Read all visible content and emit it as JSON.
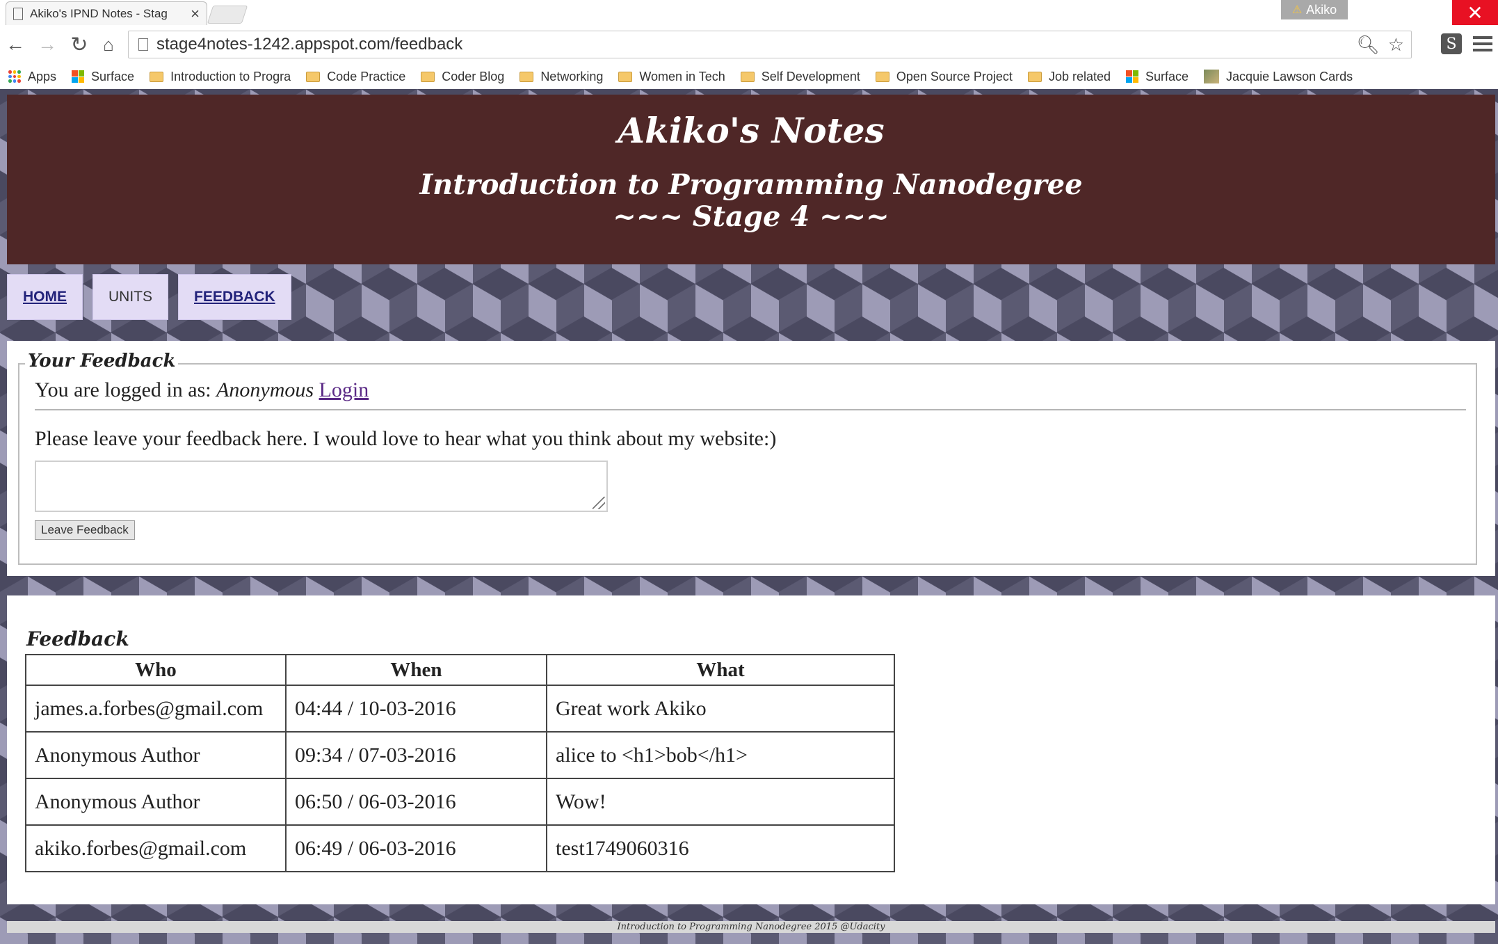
{
  "browser": {
    "tab_title": "Akiko's IPND Notes - Stag",
    "tab_close": "×",
    "profile_name": "Akiko",
    "url": "stage4notes-1242.appspot.com/feedback",
    "extension_glyph": "S",
    "bookmarks": [
      {
        "label": "Apps",
        "icon": "apps-grid-icon"
      },
      {
        "label": "Surface",
        "icon": "microsoft-logo-icon"
      },
      {
        "label": "Introduction to Progra",
        "icon": "folder-icon"
      },
      {
        "label": "Code Practice",
        "icon": "folder-icon"
      },
      {
        "label": "Coder Blog",
        "icon": "folder-icon"
      },
      {
        "label": "Networking",
        "icon": "folder-icon"
      },
      {
        "label": "Women in Tech",
        "icon": "folder-icon"
      },
      {
        "label": "Self Development",
        "icon": "folder-icon"
      },
      {
        "label": "Open Source Project",
        "icon": "folder-icon"
      },
      {
        "label": "Job related",
        "icon": "folder-icon"
      },
      {
        "label": "Surface",
        "icon": "microsoft-logo-icon"
      },
      {
        "label": "Jacquie Lawson Cards",
        "icon": "picture-icon"
      }
    ]
  },
  "site": {
    "title": "Akiko's Notes",
    "subtitle": "Introduction to Programming Nanodegree",
    "stage": "~~~ Stage 4 ~~~"
  },
  "nav": {
    "home": "HOME",
    "units": "UNITS",
    "feedback": "FEEDBACK"
  },
  "feedback_form": {
    "legend": "Your Feedback",
    "logged_in_prefix": "You are logged in as: ",
    "user": "Anonymous",
    "login_link": "Login",
    "prompt": "Please leave your feedback here. I would love to hear what you think about my website:)",
    "textarea_value": "",
    "submit_label": "Leave Feedback"
  },
  "feedback_list": {
    "title": "Feedback",
    "columns": [
      "Who",
      "When",
      "What"
    ],
    "rows": [
      {
        "who": "james.a.forbes@gmail.com",
        "when": "04:44 / 10-03-2016",
        "what": "Great work Akiko"
      },
      {
        "who": "Anonymous Author",
        "when": "09:34 / 07-03-2016",
        "what": "alice to <h1>bob</h1>"
      },
      {
        "who": "Anonymous Author",
        "when": "06:50 / 06-03-2016",
        "what": "Wow!"
      },
      {
        "who": "akiko.forbes@gmail.com",
        "when": "06:49 / 06-03-2016",
        "what": "test1749060316"
      }
    ]
  },
  "footer": "Introduction to Programming Nanodegree 2015 @Udacity",
  "colors": {
    "header_bg": "#4f2727",
    "nav_bg": "#e3dcf5",
    "link": "#5b2a86",
    "close_button": "#e81123"
  }
}
